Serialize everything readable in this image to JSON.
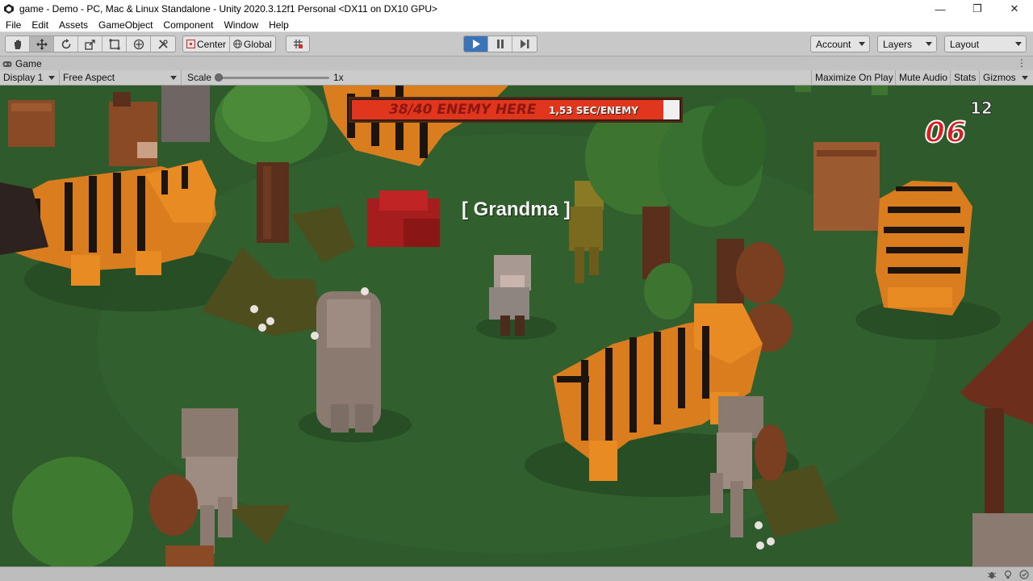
{
  "window": {
    "title": "game - Demo - PC, Mac & Linux Standalone - Unity 2020.3.12f1 Personal <DX11 on DX10 GPU>",
    "minimize": "—",
    "maximize": "❐",
    "close": "✕"
  },
  "menu": {
    "items": [
      "File",
      "Edit",
      "Assets",
      "GameObject",
      "Component",
      "Window",
      "Help"
    ]
  },
  "toolbar": {
    "pivot_label": "Center",
    "space_label": "Global",
    "account_label": "Account",
    "layers_label": "Layers",
    "layout_label": "Layout"
  },
  "game_tab": {
    "label": "Game",
    "kebab": "⋮"
  },
  "game_toolbar": {
    "display": "Display 1",
    "aspect": "Free Aspect",
    "scale_label": "Scale",
    "scale_value": "1x",
    "scale_level": 0.0,
    "maximize_on_play": "Maximize On Play",
    "mute_audio": "Mute Audio",
    "stats": "Stats",
    "gizmos": "Gizmos"
  },
  "hud": {
    "enemy_count": "38/40 ENEMY HERE",
    "enemy_rate": "1,53 SEC/ENEMY",
    "enemy_fraction": 0.95,
    "timer_main": "06",
    "timer_sub": "12",
    "target_label": "[ Grandma ]"
  },
  "colors": {
    "play_active": "#3b73b9",
    "grass": "#2e5a2b",
    "hud_red": "#e0361e",
    "timer_red": "#d81e1e"
  }
}
